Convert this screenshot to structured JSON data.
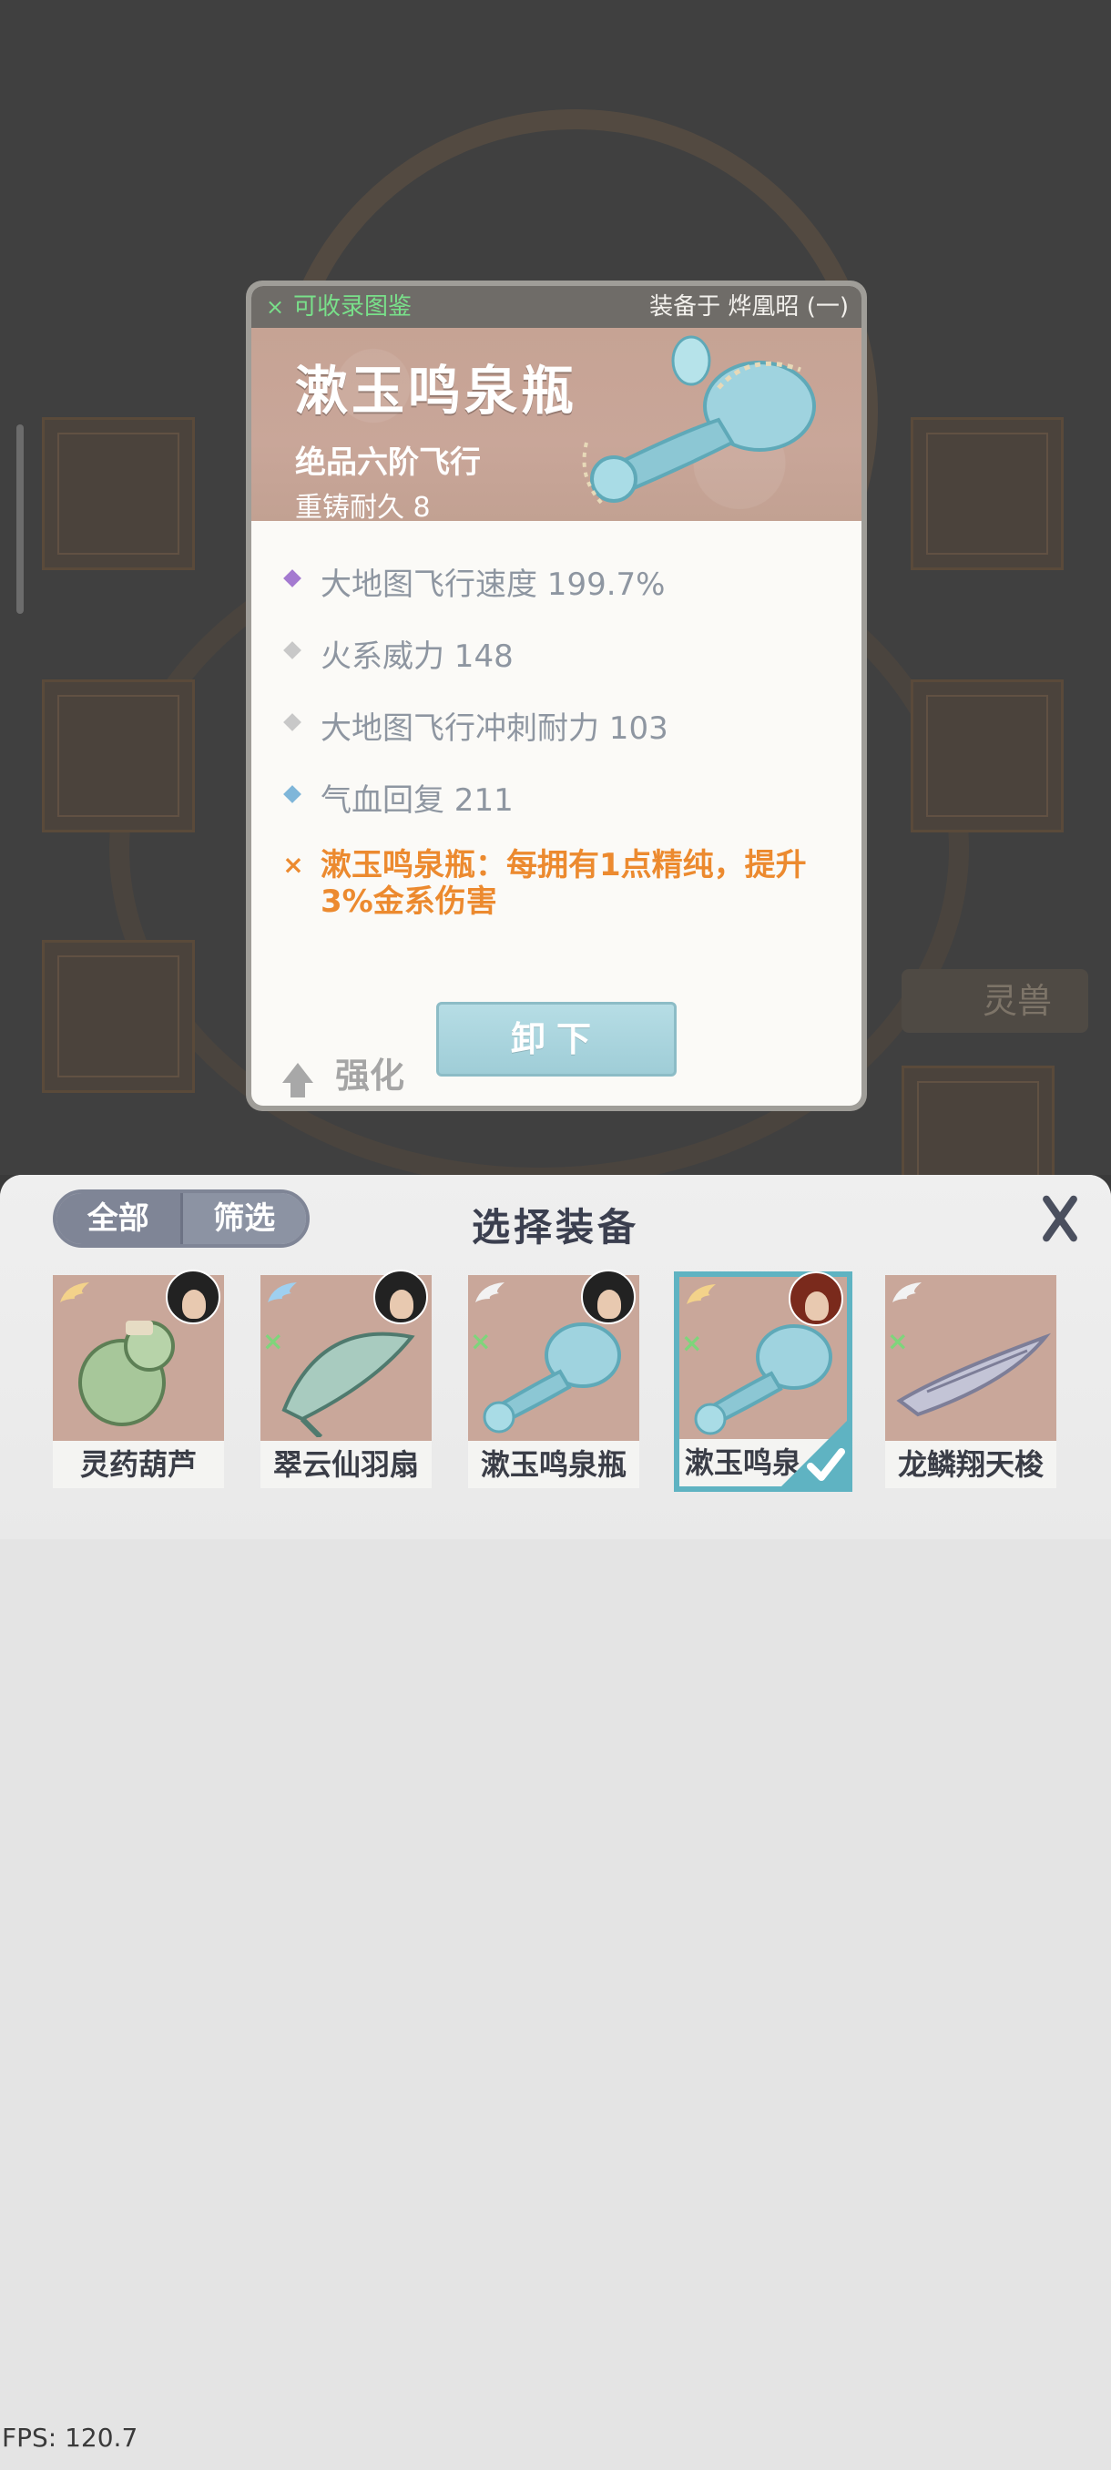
{
  "popup": {
    "collect_label": "可收录图鉴",
    "equipped_label": "装备于 烨凰昭 (一)",
    "item_name": "漱玉鸣泉瓶",
    "grade": "绝品六阶飞行",
    "durability": "重铸耐久 8",
    "stats": [
      {
        "text": "大地图飞行速度 199.7%",
        "color": "#a47ad0"
      },
      {
        "text": "火系威力 148",
        "color": "#c8c8c8"
      },
      {
        "text": "大地图飞行冲刺耐力 103",
        "color": "#c8c8c8"
      },
      {
        "text": "气血回复 211",
        "color": "#7fb6d9"
      }
    ],
    "special": "漱玉鸣泉瓶：每拥有1点精纯，提升3%金系伤害",
    "strengthen_label": "强化",
    "unequip_label": "卸下"
  },
  "background": {
    "side_label": "灵兽"
  },
  "panel": {
    "tabs": [
      "全部",
      "筛选"
    ],
    "title": "选择装备",
    "items": [
      {
        "name": "灵药葫芦",
        "selected": false
      },
      {
        "name": "翠云仙羽扇",
        "selected": false
      },
      {
        "name": "漱玉鸣泉瓶",
        "selected": false
      },
      {
        "name": "漱玉鸣泉",
        "selected": true
      },
      {
        "name": "龙鳞翔天梭",
        "selected": false
      }
    ]
  },
  "fps": "FPS: 120.7",
  "colors": {
    "accent_teal": "#5fb3c2",
    "special_orange": "#ec8a2f",
    "collect_green": "#79e08a"
  }
}
